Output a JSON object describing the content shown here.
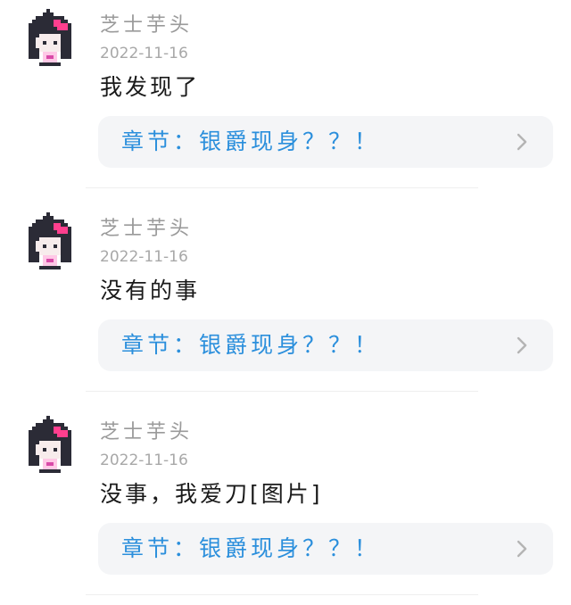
{
  "comments": [
    {
      "user": "芝士芋头",
      "date": "2022-11-16",
      "message": "我发现了",
      "chapter_link": "章节：银爵现身？？！"
    },
    {
      "user": "芝士芋头",
      "date": "2022-11-16",
      "message": "没有的事",
      "chapter_link": "章节：银爵现身？？！"
    },
    {
      "user": "芝士芋头",
      "date": "2022-11-16",
      "message": "没事，我爱刀[图片]",
      "chapter_link": "章节：银爵现身？？！"
    }
  ],
  "colors": {
    "username": "#9a9a9a",
    "date": "#a8a8a8",
    "message": "#1a1a1a",
    "chapter_link": "#2b8fdc",
    "card_bg": "#f4f5f7",
    "avatar_bow": "#ff3f8e"
  },
  "icons": {
    "avatar": "pixel-girl-avatar-icon",
    "chevron": "chevron-right-icon"
  }
}
